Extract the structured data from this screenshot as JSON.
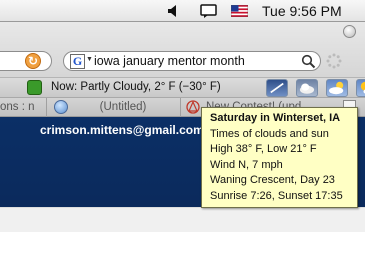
{
  "menubar": {
    "clock": "Tue 9:56 PM",
    "icons": [
      "volume-icon",
      "chat-icon",
      "us-flag-icon"
    ]
  },
  "toolbar": {
    "search": {
      "engine_icon": "G",
      "value": "iowa january mentor month"
    }
  },
  "weather_toolbar": {
    "current": "Now: Partly Cloudy, 2° F (−30° F)",
    "forecast_icons": [
      "wind-icon",
      "cloudy-icon",
      "partly-cloudy-icon",
      "sunny-cloudy-icon"
    ]
  },
  "tabs": [
    {
      "label": "ons : n"
    },
    {
      "label": "(Untitled)"
    },
    {
      "label": "New Contest! (upd"
    }
  ],
  "page": {
    "email": "crimson.mittens@gmail.com"
  },
  "tooltip": {
    "title": "Saturday in Winterset, IA",
    "lines": [
      "Times of clouds and sun",
      " High 38° F, Low 21° F",
      "Wind N, 7 mph",
      "Waning Crescent, Day 23",
      "Sunrise 7:26, Sunset 17:35"
    ]
  },
  "colors": {
    "banner": "#0b2f66",
    "tooltip_bg": "#ffffc4"
  }
}
